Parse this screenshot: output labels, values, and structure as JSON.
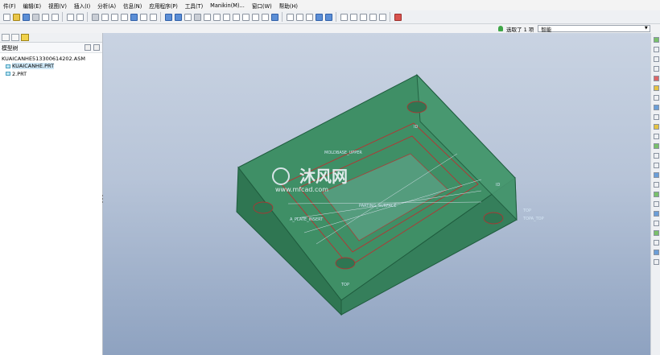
{
  "menu": [
    "件(F)",
    "编辑(E)",
    "视图(V)",
    "插入(I)",
    "分析(A)",
    "信息(N)",
    "应用程序(P)",
    "工具(T)",
    "Manikin(M)...",
    "窗口(W)",
    "帮助(H)"
  ],
  "selection": {
    "status": "选取了 1 项",
    "filter_value": "智能"
  },
  "tree": {
    "title": "模型树",
    "items": [
      {
        "label": "KUAICANHE513300614202.ASM"
      },
      {
        "label": "KUAICANHE.PRT",
        "highlighted": true
      },
      {
        "label": "2.PRT"
      }
    ]
  },
  "model_labels": {
    "label_a": "MOLDBASE_UPPER",
    "label_b": "PARTING_SURFACE",
    "label_c": "A_PLATE_INSERT",
    "label_d": "ID",
    "label_e": "ID",
    "label_f": "TOP",
    "label_g": "TOP",
    "label_h": "TOPA_TOP"
  },
  "watermark": {
    "brand": "沐风网",
    "url": "www.mfcad.com"
  },
  "colors": {
    "model_fill": "#3f8f66",
    "model_edge": "#1f5c3e",
    "accent_red": "#c8262b",
    "viewport_top": "#c9d3e2",
    "viewport_bottom": "#8ea2c0"
  }
}
